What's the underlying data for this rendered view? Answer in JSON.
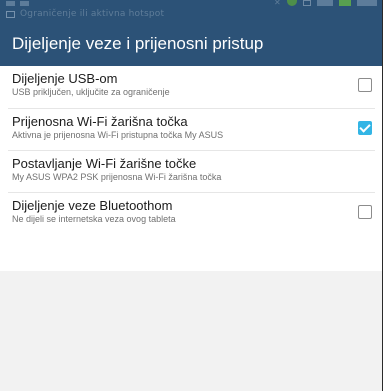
{
  "status_bar": {
    "notification_text": "Ograničenje ili aktivna hotspot"
  },
  "action_bar": {
    "title": "Dijeljenje veze i prijenosni pristup"
  },
  "settings": [
    {
      "title": "Dijeljenje USB-om",
      "summary": "USB priključen, uključite za ograničenje",
      "has_checkbox": true,
      "checked": false
    },
    {
      "title": "Prijenosna Wi-Fi žarišna točka",
      "summary": "Aktivna je prijenosna Wi-Fi pristupna točka My ASUS",
      "has_checkbox": true,
      "checked": true
    },
    {
      "title": "Postavljanje Wi-Fi žarišne točke",
      "summary": "My ASUS WPA2 PSK prijenosna Wi-Fi žarišna točka",
      "has_checkbox": false,
      "checked": false
    },
    {
      "title": "Dijeljenje veze Bluetoothom",
      "summary": "Ne dijeli se internetska veza ovog tableta",
      "has_checkbox": true,
      "checked": false
    }
  ],
  "colors": {
    "bar": "#2c5277",
    "accent": "#33b5e5",
    "background": "#f2f2f2"
  }
}
